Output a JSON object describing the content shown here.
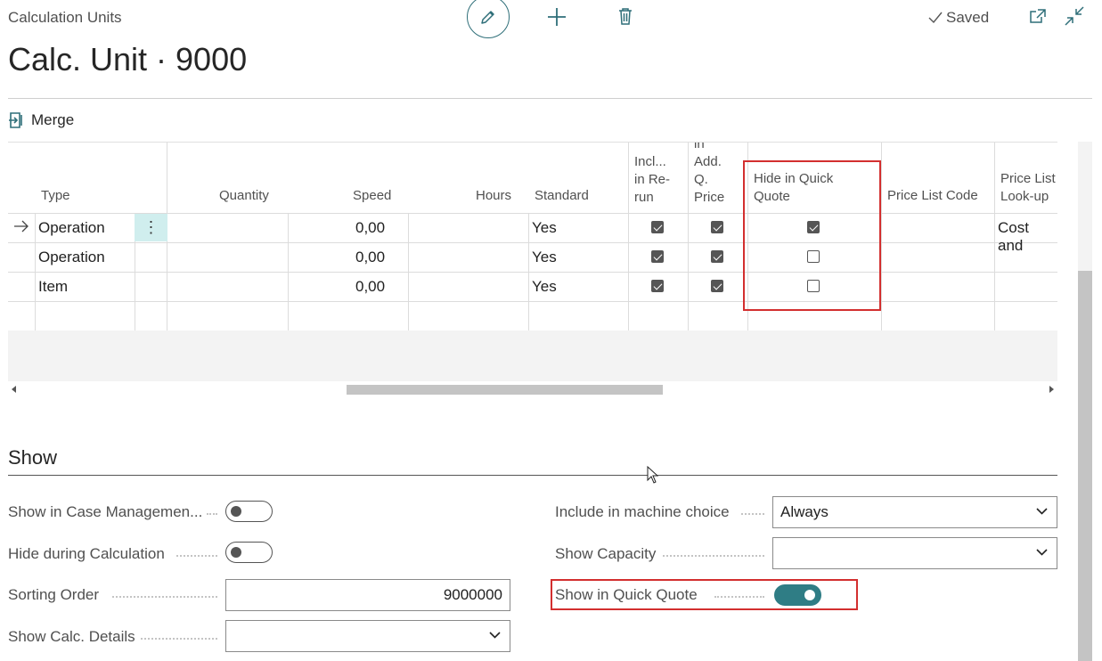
{
  "header": {
    "breadcrumb": "Calculation Units",
    "title": "Calc. Unit · 9000",
    "status": "Saved",
    "icons": [
      "pencil-icon",
      "plus-icon",
      "trash-icon",
      "check-icon",
      "open-new-window-icon",
      "collapse-icon"
    ]
  },
  "toolbar": {
    "merge_label": "Merge"
  },
  "grid": {
    "columns": {
      "type": "Type",
      "quantity": "Quantity",
      "speed": "Speed",
      "hours": "Hours",
      "standard": "Standard",
      "incl_rerun": [
        "Incl...",
        "in Re-",
        "run"
      ],
      "incl_add_q": [
        "in",
        "Add.",
        "Q.",
        "Price"
      ],
      "hide_in_quick_quote": [
        "Hide in Quick",
        "Quote"
      ],
      "price_list_code": "Price List Code",
      "price_list_lookup": [
        "Price List",
        "Look-up"
      ]
    },
    "rows": [
      {
        "type": "Operation",
        "speed": "0,00",
        "standard": "Yes",
        "incl_rerun": true,
        "incl_add_q": true,
        "hide_in_quick_quote": true,
        "price_list_lookup": "Cost and"
      },
      {
        "type": "Operation",
        "speed": "0,00",
        "standard": "Yes",
        "incl_rerun": true,
        "incl_add_q": true,
        "hide_in_quick_quote": false,
        "price_list_lookup": ""
      },
      {
        "type": "Item",
        "speed": "0,00",
        "standard": "Yes",
        "incl_rerun": true,
        "incl_add_q": true,
        "hide_in_quick_quote": false,
        "price_list_lookup": ""
      }
    ]
  },
  "show_section": {
    "title": "Show",
    "fields": {
      "show_in_case_management": {
        "label": "Show in Case Managemen...",
        "value": false
      },
      "hide_during_calculation": {
        "label": "Hide during Calculation",
        "value": false
      },
      "sorting_order": {
        "label": "Sorting Order",
        "value": "9000000"
      },
      "show_calc_details": {
        "label": "Show Calc. Details",
        "value": ""
      },
      "include_in_machine_choice": {
        "label": "Include in machine choice",
        "value": "Always"
      },
      "show_capacity": {
        "label": "Show Capacity",
        "value": ""
      },
      "show_in_quick_quote": {
        "label": "Show in Quick Quote",
        "value": true
      }
    }
  },
  "colors": {
    "accent": "#2f7d85",
    "highlight": "#d32f2f",
    "selected_row": "#d0eeee"
  }
}
